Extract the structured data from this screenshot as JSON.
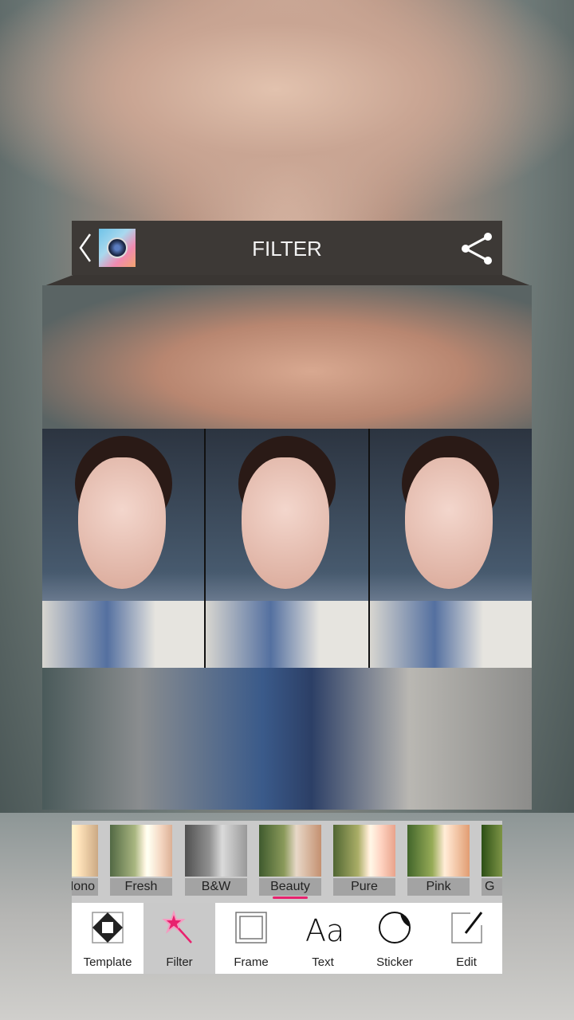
{
  "header": {
    "title": "FILTER",
    "back_icon": "chevron-left-icon",
    "app_icon": "camera-logo-icon",
    "share_icon": "share-icon"
  },
  "filters": [
    {
      "label": "Mono"
    },
    {
      "label": "Fresh"
    },
    {
      "label": "B&W"
    },
    {
      "label": "Beauty"
    },
    {
      "label": "Pure"
    },
    {
      "label": "Pink"
    },
    {
      "label": "G"
    }
  ],
  "selected_filter": "Beauty",
  "toolbar": [
    {
      "label": "Template"
    },
    {
      "label": "Filter"
    },
    {
      "label": "Frame"
    },
    {
      "label": "Text"
    },
    {
      "label": "Sticker"
    },
    {
      "label": "Edit"
    }
  ],
  "selected_tool": "Filter",
  "colors": {
    "accent": "#e8226e",
    "header_bg": "#3d3936"
  }
}
